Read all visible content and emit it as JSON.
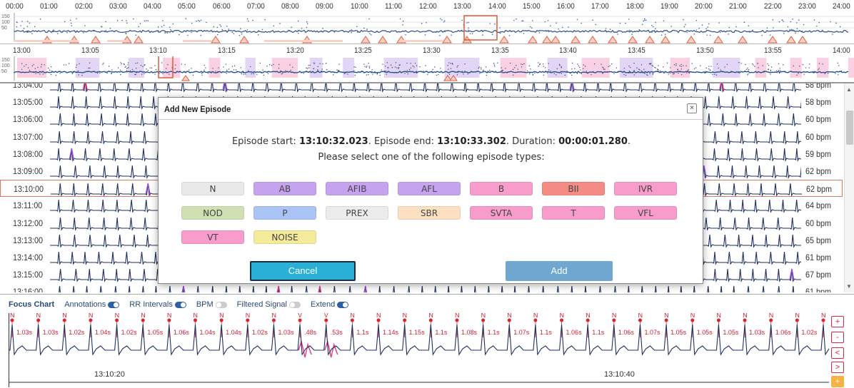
{
  "overview": {
    "hour_labels": [
      "00:00",
      "01:00",
      "02:00",
      "03:00",
      "04:00",
      "05:00",
      "06:00",
      "07:00",
      "08:00",
      "09:00",
      "10:00",
      "11:00",
      "12:00",
      "13:00",
      "14:00",
      "15:00",
      "16:00",
      "17:00",
      "18:00",
      "19:00",
      "20:00",
      "21:00",
      "22:00",
      "23:00",
      "24:00"
    ],
    "y_ticks": [
      "150",
      "100",
      "50"
    ]
  },
  "zoom": {
    "labels": [
      "13:00",
      "13:05",
      "13:10",
      "13:15",
      "13:20",
      "13:25",
      "13:30",
      "13:35",
      "13:40",
      "13:45",
      "13:50",
      "13:55",
      "14:00"
    ],
    "y_ticks": [
      "150",
      "100",
      "50"
    ]
  },
  "ecg_rows": [
    {
      "time": "13:04:00",
      "bpm": "58 bpm"
    },
    {
      "time": "13:05:00",
      "bpm": "58 bpm"
    },
    {
      "time": "13:06:00",
      "bpm": "60 bpm"
    },
    {
      "time": "13:07:00",
      "bpm": "60 bpm"
    },
    {
      "time": "13:08:00",
      "bpm": "59 bpm"
    },
    {
      "time": "13:09:00",
      "bpm": "62 bpm"
    },
    {
      "time": "13:10:00",
      "bpm": "62 bpm"
    },
    {
      "time": "13:11:00",
      "bpm": "64 bpm"
    },
    {
      "time": "13:12:00",
      "bpm": "60 bpm"
    },
    {
      "time": "13:13:00",
      "bpm": "65 bpm"
    },
    {
      "time": "13:14:00",
      "bpm": "61 bpm"
    },
    {
      "time": "13:15:00",
      "bpm": "67 bpm"
    },
    {
      "time": "13:16:00",
      "bpm": "61 bpm"
    }
  ],
  "modal": {
    "title": "Add New Episode",
    "close_label": "×",
    "start_label": "Episode start: ",
    "start_value": "13:10:32.023",
    "end_label": ". Episode end: ",
    "end_value": "13:10:33.302",
    "duration_label": ". Duration: ",
    "duration_value": "00:00:01.280",
    "duration_suffix": ".",
    "prompt": "Please select one of the following episode types:",
    "episode_types": [
      {
        "label": "N",
        "color": "#e9e9e9"
      },
      {
        "label": "AB",
        "color": "#c5a3ef"
      },
      {
        "label": "AFIB",
        "color": "#c5a3ef"
      },
      {
        "label": "AFL",
        "color": "#c5a3ef"
      },
      {
        "label": "B",
        "color": "#f79ccb"
      },
      {
        "label": "BII",
        "color": "#f48b84"
      },
      {
        "label": "IVR",
        "color": "#f79ccb"
      },
      {
        "label": "NOD",
        "color": "#cfe0b3"
      },
      {
        "label": "P",
        "color": "#a9c4f5"
      },
      {
        "label": "PREX",
        "color": "#ececec"
      },
      {
        "label": "SBR",
        "color": "#fde0c2"
      },
      {
        "label": "SVTA",
        "color": "#f79ccb"
      },
      {
        "label": "T",
        "color": "#f79ccb"
      },
      {
        "label": "VFL",
        "color": "#f79ccb"
      },
      {
        "label": "VT",
        "color": "#f79ccb"
      },
      {
        "label": "NOISE",
        "color": "#f3ea9a"
      }
    ],
    "cancel_label": "Cancel",
    "add_label": "Add"
  },
  "focus": {
    "title": "Focus Chart",
    "toggles": [
      {
        "label": "Annotations",
        "on": true
      },
      {
        "label": "RR Intervals",
        "on": true
      },
      {
        "label": "BPM",
        "on": false
      },
      {
        "label": "Filtered Signal",
        "on": false
      },
      {
        "label": "Extend",
        "on": true
      }
    ],
    "beats": [
      {
        "label": "N",
        "rr": "1.03s"
      },
      {
        "label": "N",
        "rr": "1.03s"
      },
      {
        "label": "N",
        "rr": "1.02s"
      },
      {
        "label": "N",
        "rr": "1.04s"
      },
      {
        "label": "N",
        "rr": "1.02s"
      },
      {
        "label": "N",
        "rr": "1.05s"
      },
      {
        "label": "N",
        "rr": "1.06s"
      },
      {
        "label": "N",
        "rr": "1.04s"
      },
      {
        "label": "N",
        "rr": "1.04s"
      },
      {
        "label": "N",
        "rr": "1.02s"
      },
      {
        "label": "N",
        "rr": "1.03s"
      },
      {
        "label": "V",
        "rr": ".48s"
      },
      {
        "label": "V",
        "rr": ".53s"
      },
      {
        "label": "N",
        "rr": "1.1s"
      },
      {
        "label": "N",
        "rr": "1.14s"
      },
      {
        "label": "N",
        "rr": "1.15s"
      },
      {
        "label": "N",
        "rr": "1.1s"
      },
      {
        "label": "N",
        "rr": "1.08s"
      },
      {
        "label": "N",
        "rr": "1.1s"
      },
      {
        "label": "N",
        "rr": "1.07s"
      },
      {
        "label": "N",
        "rr": "1.1s"
      },
      {
        "label": "N",
        "rr": "1.06s"
      },
      {
        "label": "N",
        "rr": "1.1s"
      },
      {
        "label": "N",
        "rr": "1.06s"
      },
      {
        "label": "N",
        "rr": "1.07s"
      },
      {
        "label": "N",
        "rr": "1.05s"
      },
      {
        "label": "N",
        "rr": "1.05s"
      },
      {
        "label": "N",
        "rr": "1.05s"
      },
      {
        "label": "N",
        "rr": "1.03s"
      },
      {
        "label": "N",
        "rr": "1.06s"
      },
      {
        "label": "N",
        "rr": "1.02s"
      },
      {
        "label": "N",
        "rr": ""
      }
    ],
    "x_labels": [
      "13:10:20",
      "13:10:40"
    ],
    "buttons": {
      "zoom_in": "+",
      "zoom_out": "-",
      "prev": "<",
      "next": ">",
      "add": "+"
    }
  }
}
